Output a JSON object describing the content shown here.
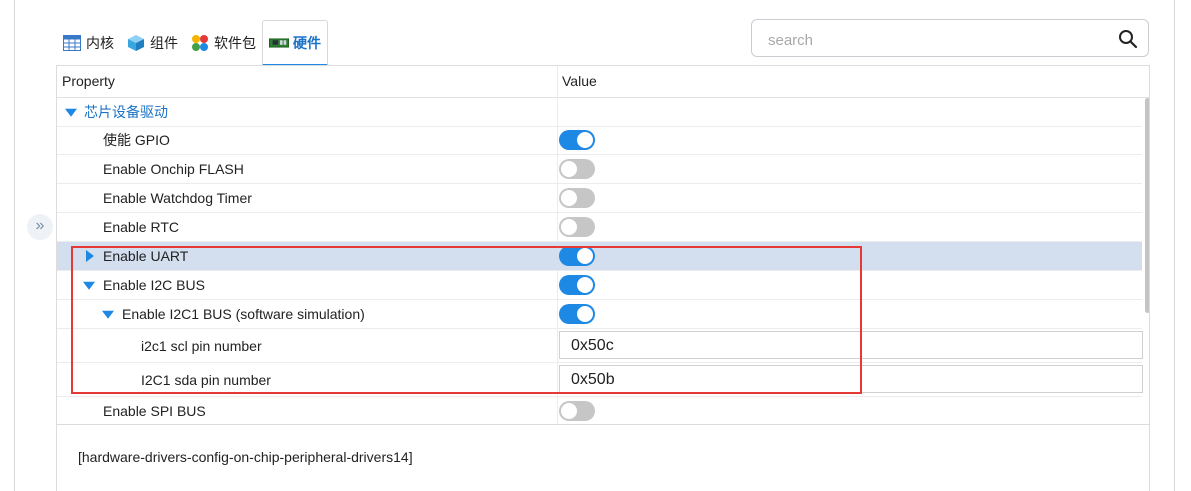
{
  "tabs": [
    {
      "label": "内核",
      "icon": "table-icon",
      "active": false
    },
    {
      "label": "组件",
      "icon": "cube-icon",
      "active": false
    },
    {
      "label": "软件包",
      "icon": "packages-icon",
      "active": false
    },
    {
      "label": "硬件",
      "icon": "board-icon",
      "active": true
    }
  ],
  "search": {
    "placeholder": "search",
    "value": ""
  },
  "table": {
    "columns": [
      "Property",
      "Value"
    ],
    "rows": [
      {
        "label": "芯片设备驱动",
        "kind": "category",
        "expanded": true
      },
      {
        "label": "使能 GPIO",
        "kind": "toggle",
        "value": true
      },
      {
        "label": "Enable Onchip FLASH",
        "kind": "toggle",
        "value": false
      },
      {
        "label": "Enable Watchdog Timer",
        "kind": "toggle",
        "value": false
      },
      {
        "label": "Enable RTC",
        "kind": "toggle",
        "value": false
      },
      {
        "label": "Enable UART",
        "kind": "toggle",
        "value": true,
        "expanded": false,
        "selected": true
      },
      {
        "label": "Enable I2C BUS",
        "kind": "toggle",
        "value": true,
        "expanded": true
      },
      {
        "label": "Enable I2C1 BUS (software simulation)",
        "kind": "toggle",
        "value": true,
        "expanded": true
      },
      {
        "label": "i2c1 scl pin number",
        "kind": "text",
        "value": "0x50c"
      },
      {
        "label": "I2C1 sda pin number",
        "kind": "text",
        "value": "0x50b"
      },
      {
        "label": "Enable SPI BUS",
        "kind": "toggle",
        "value": false
      }
    ]
  },
  "description": "[hardware-drivers-config-on-chip-peripheral-drivers14]",
  "colors": {
    "accent": "#1e88e5",
    "selected_row": "#d3deef",
    "highlight_box": "#e53935",
    "toggle_off": "#c6c6c6"
  }
}
